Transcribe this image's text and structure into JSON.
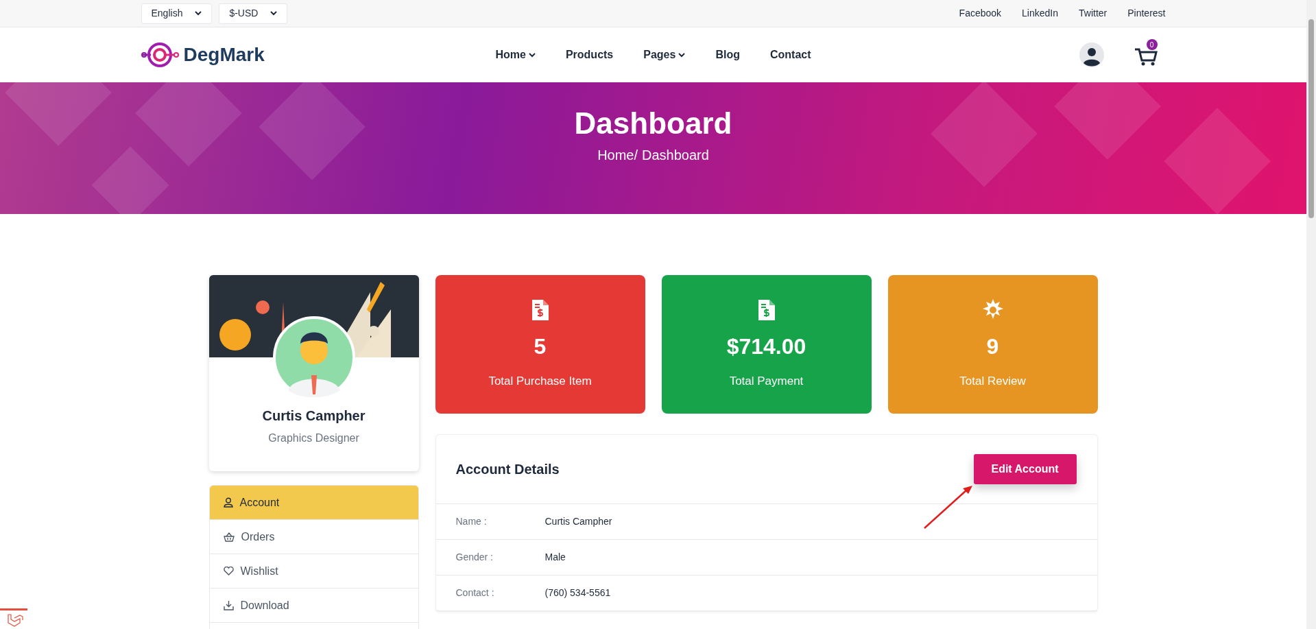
{
  "top_bar": {
    "selectors": [
      {
        "label": "English"
      },
      {
        "label": "$-USD"
      }
    ],
    "social_links": [
      "Facebook",
      "LinkedIn",
      "Twitter",
      "Pinterest"
    ]
  },
  "header": {
    "logo": "DegMark",
    "nav": [
      {
        "label": "Home",
        "dropdown": true
      },
      {
        "label": "Products",
        "dropdown": false
      },
      {
        "label": "Pages",
        "dropdown": true
      },
      {
        "label": "Blog",
        "dropdown": false
      },
      {
        "label": "Contact",
        "dropdown": false
      }
    ],
    "cart_count": "0"
  },
  "hero": {
    "title": "Dashboard",
    "breadcrumb": [
      "Home/",
      "Dashboard"
    ]
  },
  "profile": {
    "name": "Curtis Campher",
    "role": "Graphics Designer"
  },
  "sidebar": {
    "items": [
      {
        "label": "Account",
        "kind": "user",
        "selected": true
      },
      {
        "label": "Orders",
        "kind": "basket",
        "selected": false
      },
      {
        "label": "Wishlist",
        "kind": "heart",
        "selected": false
      },
      {
        "label": "Download",
        "kind": "download",
        "selected": false
      }
    ]
  },
  "stats": [
    {
      "value": "5",
      "label": "Total Purchase Item",
      "kind": "invoice",
      "color": "#e53935"
    },
    {
      "value": "$714.00",
      "label": "Total Payment",
      "kind": "invoice",
      "color": "#16a34a"
    },
    {
      "value": "9",
      "label": "Total Review",
      "kind": "badge",
      "color": "#e69522"
    }
  ],
  "account_details": {
    "title": "Account Details",
    "edit_button": "Edit Account",
    "fields": [
      {
        "label": "Name :",
        "value": "Curtis Campher"
      },
      {
        "label": "Gender :",
        "value": "Male"
      },
      {
        "label": "Contact :",
        "value": "(760) 534-5561"
      }
    ]
  }
}
